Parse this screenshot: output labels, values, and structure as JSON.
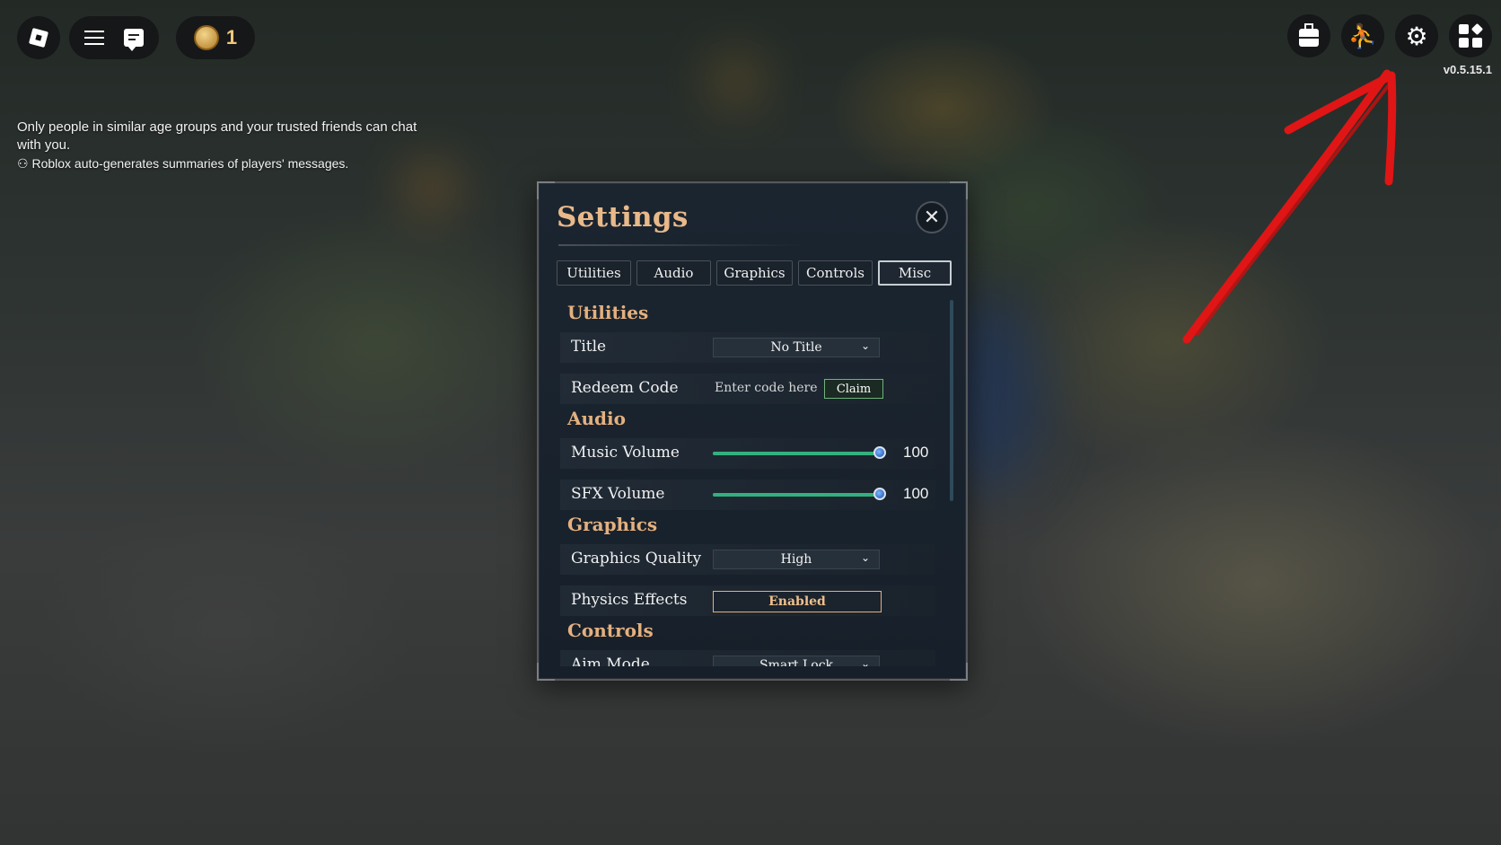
{
  "topbar": {
    "coin_count": "1",
    "version": "v0.5.15.1"
  },
  "chat_notice": {
    "line1": "Only people in similar age groups and your trusted friends can chat with you.",
    "line2": "Roblox auto-generates summaries of players' messages."
  },
  "settings": {
    "title": "Settings",
    "tabs": [
      {
        "label": "Utilities"
      },
      {
        "label": "Audio"
      },
      {
        "label": "Graphics"
      },
      {
        "label": "Controls"
      },
      {
        "label": "Misc",
        "active": true
      }
    ],
    "sections": {
      "utilities": "Utilities",
      "audio": "Audio",
      "graphics": "Graphics",
      "controls": "Controls"
    },
    "title_setting": {
      "label": "Title",
      "value": "No Title"
    },
    "redeem_code": {
      "label": "Redeem Code",
      "placeholder": "Enter code here",
      "button": "Claim"
    },
    "music_volume": {
      "label": "Music Volume",
      "value": "100",
      "fraction": 1.0
    },
    "sfx_volume": {
      "label": "SFX Volume",
      "value": "100",
      "fraction": 1.0
    },
    "graphics_quality": {
      "label": "Graphics Quality",
      "value": "High"
    },
    "physics_effects": {
      "label": "Physics Effects",
      "value": "Enabled"
    },
    "aim_mode": {
      "label": "Aim Mode",
      "value": "Smart Lock"
    }
  },
  "colors": {
    "accent_title": "#e9b98a",
    "slider_fill": "#33b07f",
    "annotation_arrow": "#e01515"
  }
}
